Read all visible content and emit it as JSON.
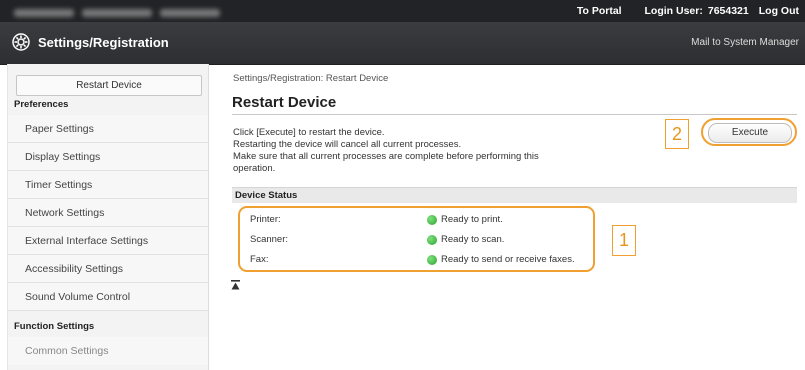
{
  "topbar": {
    "portal_label": "To Portal",
    "login_label": "Login User:",
    "login_user": "7654321",
    "logout_label": "Log Out"
  },
  "header": {
    "title": "Settings/Registration",
    "mail_link": "Mail to System Manager"
  },
  "sidebar": {
    "restart_button": "Restart Device",
    "preferences_heading": "Preferences",
    "items": [
      {
        "label": "Paper Settings"
      },
      {
        "label": "Display Settings"
      },
      {
        "label": "Timer Settings"
      },
      {
        "label": "Network Settings"
      },
      {
        "label": "External Interface Settings"
      },
      {
        "label": "Accessibility Settings"
      },
      {
        "label": "Sound Volume Control"
      }
    ],
    "function_heading": "Function Settings",
    "common_settings": "Common Settings"
  },
  "main": {
    "breadcrumb": "Settings/Registration: Restart Device",
    "title": "Restart Device",
    "description_lines": [
      "Click [Execute] to restart the device.",
      "Restarting the device will cancel all current processes.",
      "Make sure that all current processes are complete before performing this",
      "operation."
    ],
    "execute_button": "Execute",
    "callout_execute": "2",
    "callout_status": "1",
    "status_heading": "Device Status",
    "status_rows": [
      {
        "label": "Printer:",
        "value": "Ready to print."
      },
      {
        "label": "Scanner:",
        "value": "Ready to scan."
      },
      {
        "label": "Fax:",
        "value": "Ready to send or receive faxes."
      }
    ]
  },
  "colors": {
    "accent": "#f0a030",
    "status_ok": "#2aa52a",
    "header_bg": "#2d2e31"
  }
}
